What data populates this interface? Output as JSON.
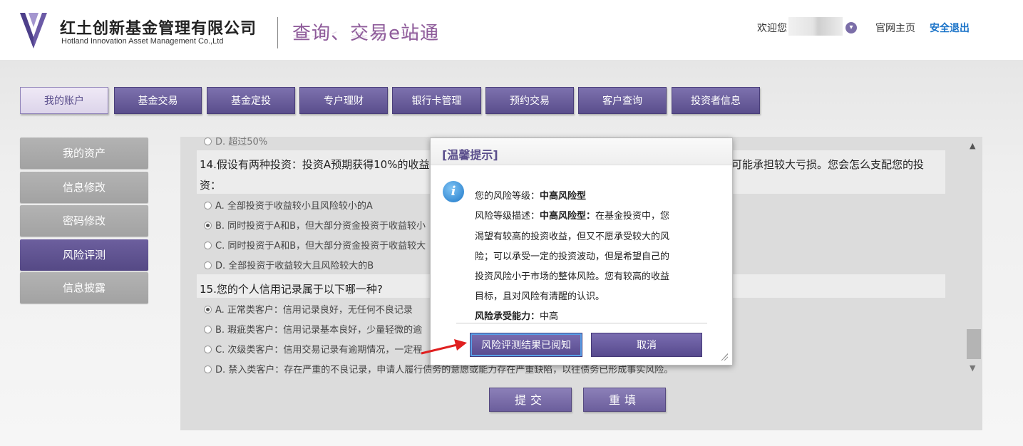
{
  "header": {
    "company_cn": "红土创新基金管理有限公司",
    "company_en": "Hotland Innovation Asset Management Co.,Ltd",
    "slogan": "查询、交易e站通",
    "welcome": "欢迎您",
    "home_link": "官网主页",
    "logout_link": "安全退出"
  },
  "nav": {
    "tabs": [
      "我的账户",
      "基金交易",
      "基金定投",
      "专户理财",
      "银行卡管理",
      "预约交易",
      "客户查询",
      "投资者信息"
    ],
    "active": "我的账户"
  },
  "sidebar": {
    "items": [
      "我的资产",
      "信息修改",
      "密码修改",
      "风险评测",
      "信息披露"
    ],
    "active": "风险评测"
  },
  "questionnaire": {
    "prev_option": "D. 超过50%",
    "q14": {
      "text_line1": "14.假设有两种投资：投资A预期获得10%的收益",
      "text_line1_tail": "可能承担较大亏损。您会怎么支配您的投",
      "text_line2": "资：",
      "options": [
        "A. 全部投资于收益较小且风险较小的A",
        "B. 同时投资于A和B，但大部分资金投资于收益较小",
        "C. 同时投资于A和B，但大部分资金投资于收益较大",
        "D. 全部投资于收益较大且风险较大的B"
      ],
      "selected": 1
    },
    "q15": {
      "text": "15.您的个人信用记录属于以下哪一种?",
      "options": [
        "A. 正常类客户：信用记录良好，无任何不良记录",
        "B. 瑕疵类客户：信用记录基本良好，少量轻微的逾",
        "C. 次级类客户：信用交易记录有逾期情况，一定程",
        "D. 禁入类客户：存在严重的不良记录，申请人履行债务的意愿或能力存在严重缺陷，以往债务已形成事实风险。"
      ],
      "selected": 0
    },
    "submit_label": "提交",
    "reset_label": "重填"
  },
  "modal": {
    "title": "[温馨提示]",
    "level_label": "您的风险等级：",
    "level_value": "中高风险型",
    "desc_label": "风险等级描述：",
    "desc_value_bold": "中高风险型：",
    "desc_lines": [
      "在基金投资中，您",
      "渴望有较高的投资收益，但又不愿承受较大的风",
      "险；可以承受一定的投资波动，但是希望自己的",
      "投资风险小于市场的整体风险。您有较高的收益",
      "目标，且对风险有清醒的认识。"
    ],
    "capacity_label": "风险承受能力：",
    "capacity_value": "中高",
    "confirm_label": "风险评测结果已阅知",
    "cancel_label": "取消"
  },
  "colors": {
    "brand_purple": "#5a4e8c",
    "link_blue": "#1a73c8",
    "arrow_red": "#e02020"
  },
  "icons": {
    "logo": "hotland-logo-icon",
    "user_menu": "chevron-down-icon",
    "info": "info-icon",
    "scroll_up": "triangle-up-icon",
    "scroll_down": "triangle-down-icon",
    "annotation": "red-arrow-icon"
  }
}
